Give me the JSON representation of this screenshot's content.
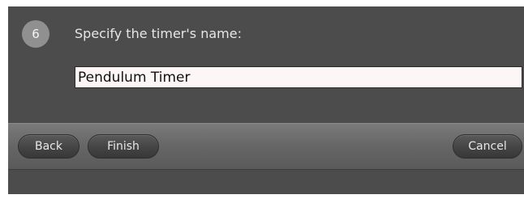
{
  "step": {
    "number": "6",
    "prompt": "Specify the timer's name:"
  },
  "timer_name_input": {
    "value": "Pendulum Timer"
  },
  "buttons": {
    "back": "Back",
    "finish": "Finish",
    "cancel": "Cancel"
  }
}
